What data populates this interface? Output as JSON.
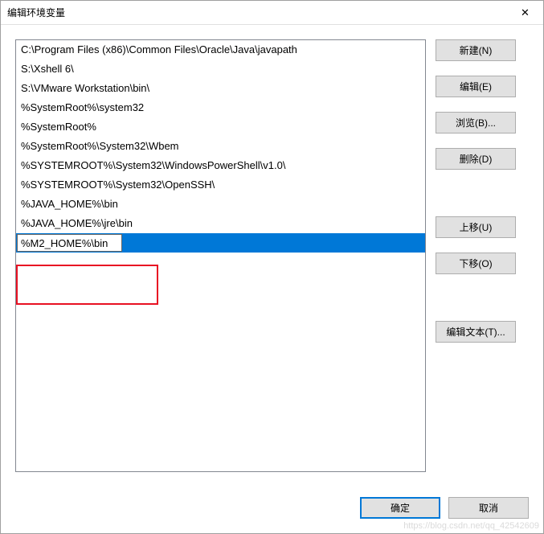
{
  "window": {
    "title": "编辑环境变量",
    "close_glyph": "✕"
  },
  "list": {
    "items": [
      "C:\\Program Files (x86)\\Common Files\\Oracle\\Java\\javapath",
      "S:\\Xshell 6\\",
      "S:\\VMware Workstation\\bin\\",
      "%SystemRoot%\\system32",
      "%SystemRoot%",
      "%SystemRoot%\\System32\\Wbem",
      "%SYSTEMROOT%\\System32\\WindowsPowerShell\\v1.0\\",
      "%SYSTEMROOT%\\System32\\OpenSSH\\",
      "%JAVA_HOME%\\bin",
      "%JAVA_HOME%\\jre\\bin"
    ],
    "edit_value": "%M2_HOME%\\bin"
  },
  "buttons": {
    "new": "新建(N)",
    "edit": "编辑(E)",
    "browse": "浏览(B)...",
    "delete": "删除(D)",
    "move_up": "上移(U)",
    "move_down": "下移(O)",
    "edit_text": "编辑文本(T)...",
    "ok": "确定",
    "cancel": "取消"
  },
  "watermark": "https://blog.csdn.net/qq_42542609"
}
